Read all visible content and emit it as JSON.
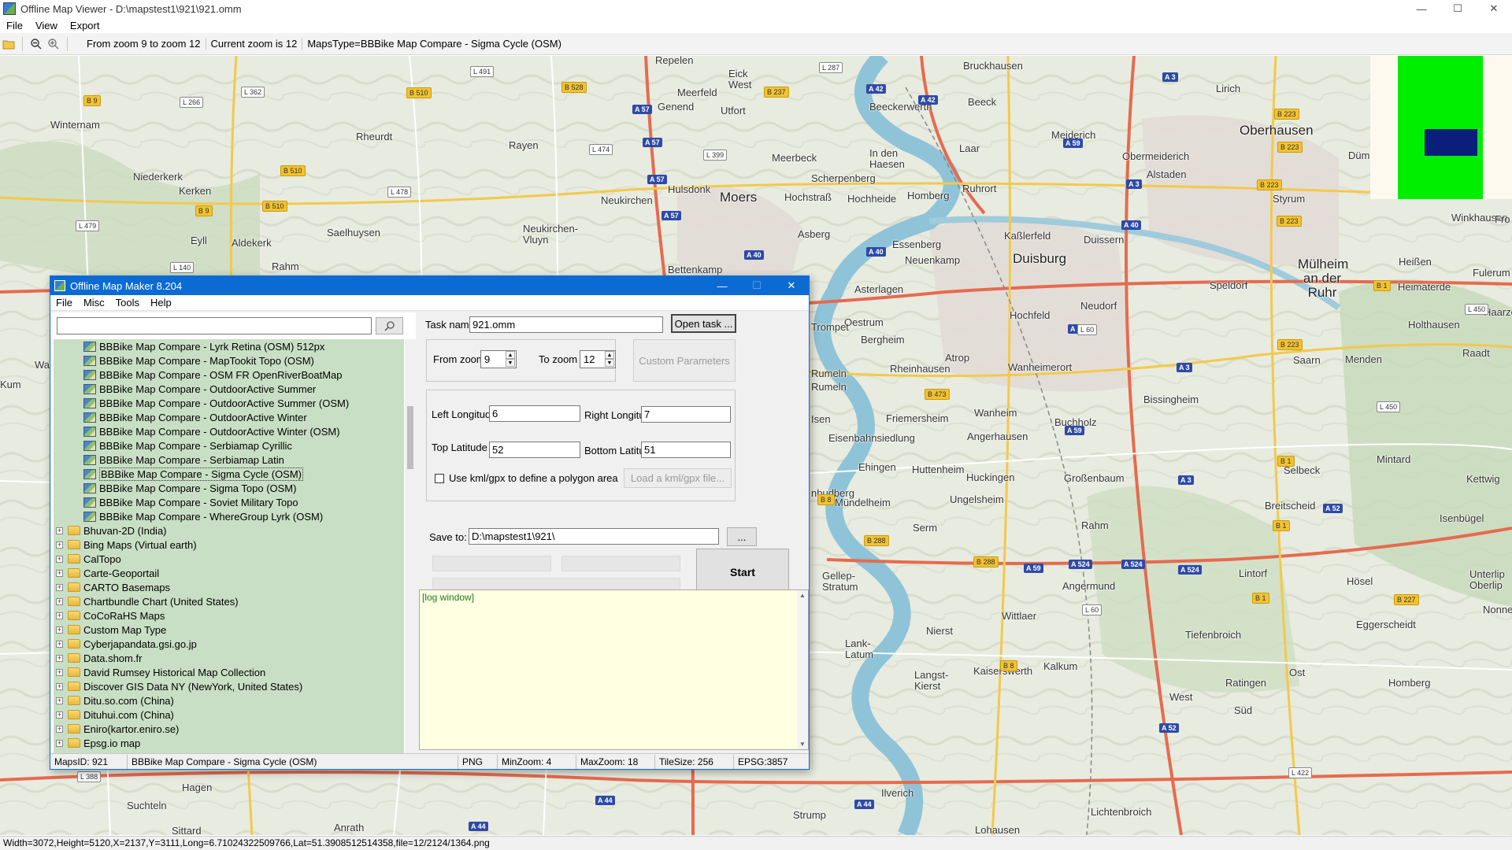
{
  "window": {
    "title": "Offline Map Viewer - D:\\mapstest1\\921\\921.omm",
    "controls": [
      "—",
      "☐",
      "✕"
    ]
  },
  "menubar": [
    "File",
    "View",
    "Export"
  ],
  "toolbar": {
    "zoom_range": "From zoom 9 to zoom 12",
    "current_zoom": "Current zoom is 12",
    "maps_type": "MapsType=BBBike Map Compare - Sigma Cycle (OSM)"
  },
  "map": {
    "places": [
      {
        "name": "Repelen"
      },
      {
        "name": "Eick West"
      },
      {
        "name": "Meerfeld"
      },
      {
        "name": "Genend"
      },
      {
        "name": "Utfort"
      },
      {
        "name": "Winternam"
      },
      {
        "name": "Rheurdt"
      },
      {
        "name": "Rayen"
      },
      {
        "name": "Niederkerk"
      },
      {
        "name": "Kerken"
      },
      {
        "name": "Hulsdonk"
      },
      {
        "name": "Moers"
      },
      {
        "name": "Meerbeck"
      },
      {
        "name": "Scherpenberg"
      },
      {
        "name": "Hochstraß"
      },
      {
        "name": "Hochheide"
      },
      {
        "name": "Neukirchen"
      },
      {
        "name": "Homberg"
      },
      {
        "name": "In den Haesen"
      },
      {
        "name": "Ruhrort"
      },
      {
        "name": "Beeck"
      },
      {
        "name": "Beeckerwerth"
      },
      {
        "name": "Bruckhausen"
      },
      {
        "name": "Laar"
      },
      {
        "name": "Meiderich"
      },
      {
        "name": "Obermeiderich"
      },
      {
        "name": "Lirich"
      },
      {
        "name": "Oberhausen"
      },
      {
        "name": "Alstaden"
      },
      {
        "name": "Dümpten"
      },
      {
        "name": "Styrum"
      },
      {
        "name": "Eyll"
      },
      {
        "name": "Aldekerk"
      },
      {
        "name": "Saelhuysen"
      },
      {
        "name": "Neukirchen-Vluyn"
      },
      {
        "name": "Asberg"
      },
      {
        "name": "Essenberg"
      },
      {
        "name": "Neuenkamp"
      },
      {
        "name": "Duisburg"
      },
      {
        "name": "Kaßlerfeld"
      },
      {
        "name": "Duissern"
      },
      {
        "name": "Mülheim an der Ruhr"
      },
      {
        "name": "Heißen"
      },
      {
        "name": "Winkhausen"
      },
      {
        "name": "Heimaterde"
      },
      {
        "name": "Fulerum"
      },
      {
        "name": "Rahm"
      },
      {
        "name": "Bettenkamp"
      },
      {
        "name": "Asterlagen"
      },
      {
        "name": "Oestrum"
      },
      {
        "name": "Bergheim"
      },
      {
        "name": "Trompet"
      },
      {
        "name": "Hochfeld"
      },
      {
        "name": "Neudorf"
      },
      {
        "name": "Speldorf"
      },
      {
        "name": "Holthausen"
      },
      {
        "name": "Atrop"
      },
      {
        "name": "Rheinhausen"
      },
      {
        "name": "Wanheimerort"
      },
      {
        "name": "Rumeln"
      },
      {
        "name": "Saarn"
      },
      {
        "name": "Menden"
      },
      {
        "name": "Raadt"
      },
      {
        "name": "Bissingheim"
      },
      {
        "name": "Friemersheim"
      },
      {
        "name": "Wanheim"
      },
      {
        "name": "Buchholz"
      },
      {
        "name": "Eisenbahnsiedlung"
      },
      {
        "name": "Angerhausen"
      },
      {
        "name": "Mintard"
      },
      {
        "name": "Selbeck"
      },
      {
        "name": "Kettwig"
      },
      {
        "name": "Ehingen"
      },
      {
        "name": "Huttenheim"
      },
      {
        "name": "Huckingen"
      },
      {
        "name": "Großenbaum"
      },
      {
        "name": "Mündelheim"
      },
      {
        "name": "Ungelsheim"
      },
      {
        "name": "Breitscheid"
      },
      {
        "name": "Isenbügel"
      },
      {
        "name": "Serm"
      },
      {
        "name": "Rahm"
      },
      {
        "name": "Gellep-Stratum"
      },
      {
        "name": "Angermund"
      },
      {
        "name": "Lintorf"
      },
      {
        "name": "Hösel"
      },
      {
        "name": "Unterlip Oberlip"
      },
      {
        "name": "Nonnenbru"
      },
      {
        "name": "Wittlaer"
      },
      {
        "name": "Nierst"
      },
      {
        "name": "Eggerscheidt"
      },
      {
        "name": "Tiefenbroich"
      },
      {
        "name": "Lank-Latum"
      },
      {
        "name": "Langst-Kierst"
      },
      {
        "name": "Kaiserswerth"
      },
      {
        "name": "Kalkum"
      },
      {
        "name": "Ratingen"
      },
      {
        "name": "Ost"
      },
      {
        "name": "Homberg"
      },
      {
        "name": "West"
      },
      {
        "name": "Süd"
      },
      {
        "name": "Hagen"
      },
      {
        "name": "Suchteln"
      },
      {
        "name": "Ilverich"
      },
      {
        "name": "Sittard"
      },
      {
        "name": "Anrath"
      },
      {
        "name": "Strump"
      },
      {
        "name": "Lichtenbroich"
      },
      {
        "name": "Lohausen"
      },
      {
        "name": "Kum"
      },
      {
        "name": "Wa"
      },
      {
        "name": "Fro"
      },
      {
        "name": "Haarzo"
      },
      {
        "name": "Rumeln"
      },
      {
        "name": "Isen"
      },
      {
        "name": "nbudberg"
      }
    ],
    "shields": [
      {
        "t": "a",
        "label": "A 42"
      },
      {
        "t": "a",
        "label": "A 57"
      },
      {
        "t": "a",
        "label": "A 40"
      },
      {
        "t": "a",
        "label": "A 3"
      },
      {
        "t": "a",
        "label": "A 59"
      },
      {
        "t": "a",
        "label": "A 524"
      },
      {
        "t": "a",
        "label": "A 52"
      },
      {
        "t": "a",
        "label": "A 44"
      },
      {
        "t": "b",
        "label": "B 9"
      },
      {
        "t": "b",
        "label": "B 510"
      },
      {
        "t": "b",
        "label": "B 528"
      },
      {
        "t": "b",
        "label": "B 237"
      },
      {
        "t": "b",
        "label": "B 223"
      },
      {
        "t": "b",
        "label": "B 288"
      },
      {
        "t": "b",
        "label": "B 1"
      },
      {
        "t": "b",
        "label": "B 227"
      },
      {
        "t": "b",
        "label": "B 8"
      },
      {
        "t": "b",
        "label": "B 473"
      },
      {
        "t": "l",
        "label": "L 491"
      },
      {
        "t": "l",
        "label": "L 362"
      },
      {
        "t": "l",
        "label": "L 266"
      },
      {
        "t": "l",
        "label": "L 287"
      },
      {
        "t": "l",
        "label": "L 474"
      },
      {
        "t": "l",
        "label": "L 399"
      },
      {
        "t": "l",
        "label": "L 478"
      },
      {
        "t": "l",
        "label": "L 140"
      },
      {
        "t": "l",
        "label": "L 479"
      },
      {
        "t": "l",
        "label": "L 60"
      },
      {
        "t": "l",
        "label": "L 450"
      },
      {
        "t": "l",
        "label": "L 422"
      },
      {
        "t": "l",
        "label": "L 388"
      }
    ]
  },
  "overview": {},
  "status": "Width=3072,Height=5120,X=2137,Y=3111,Long=6.71024322509766,Lat=51.3908512514358,file=12/2124/1364.png",
  "dialog": {
    "title": "Offline Map Maker 8.204",
    "controls": [
      "—",
      "☐",
      "✕"
    ],
    "menu": [
      "File",
      "Misc",
      "Tools",
      "Help"
    ],
    "search": {
      "value": "",
      "placeholder": ""
    },
    "tree": {
      "children": [
        "BBBike Map Compare - Lyrk Retina (OSM) 512px",
        "BBBike Map Compare - MapTookit Topo (OSM)",
        "BBBike Map Compare - OSM FR OpenRiverBoatMap",
        "BBBike Map Compare - OutdoorActive Summer",
        "BBBike Map Compare - OutdoorActive Summer (OSM)",
        "BBBike Map Compare - OutdoorActive Winter",
        "BBBike Map Compare - OutdoorActive Winter (OSM)",
        "BBBike Map Compare - Serbiamap Cyrillic",
        "BBBike Map Compare - Serbiamap Latin",
        "BBBike Map Compare - Sigma Cycle (OSM)",
        "BBBike Map Compare - Sigma Topo (OSM)",
        "BBBike Map Compare - Soviet Military Topo",
        "BBBike Map Compare - WhereGroup Lyrk (OSM)"
      ],
      "selected_child": 9,
      "folders": [
        "Bhuvan-2D (India)",
        "Bing Maps (Virtual earth)",
        "CalTopo",
        "Carte-Geoportail",
        "CARTO Basemaps",
        "Chartbundle Chart (United States)",
        "CoCoRaHS Maps",
        "Custom Map Type",
        "Cyberjapandata.gsi.go.jp",
        "Data.shom.fr",
        "David Rumsey Historical Map Collection",
        "Discover GIS Data NY (NewYork, United States)",
        "Ditu.so.com (China)",
        "Dituhui.com (China)",
        "Eniro(kartor.eniro.se)",
        "Epsg.io map"
      ]
    },
    "task_name_label": "Task name",
    "task_name_value": "921.omm",
    "open_task": "Open task ...",
    "from_zoom_label": "From zoom",
    "from_zoom_value": "9",
    "to_zoom_label": "To zoom",
    "to_zoom_value": "12",
    "custom_params": "Custom Parameters",
    "left_lon_label": "Left Longitude",
    "left_lon_value": "6",
    "right_lon_label": "Right Longitude",
    "right_lon_value": "7",
    "top_lat_label": "Top Latitude",
    "top_lat_value": "52",
    "bottom_lat_label": "Bottom Latitude",
    "bottom_lat_value": "51",
    "kml_check_label": "Use kml/gpx to define a polygon area",
    "kml_button": "Load a kml/gpx file...",
    "save_to_label": "Save to:",
    "save_to_value": "D:\\mapstest1\\921\\",
    "browse": "...",
    "start": "Start",
    "log": "[log window]",
    "statusbar": {
      "maps_id": "MapsID: 921",
      "map_name": "BBBike Map Compare - Sigma Cycle (OSM)",
      "format": "PNG",
      "min_zoom": "MinZoom: 4",
      "max_zoom": "MaxZoom: 18",
      "tile_size": "TileSize: 256",
      "epsg": "EPSG:3857"
    }
  }
}
